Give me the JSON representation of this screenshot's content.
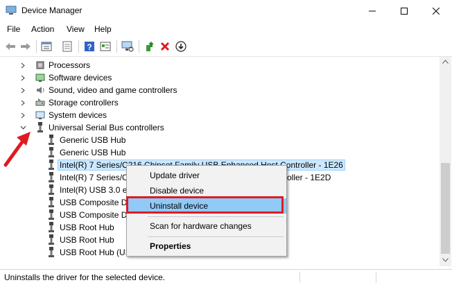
{
  "window": {
    "title": "Device Manager"
  },
  "menu": {
    "items": [
      "File",
      "Action",
      "View",
      "Help"
    ]
  },
  "toolbar": {
    "icons": [
      "back-icon",
      "forward-icon",
      "properties-icon",
      "view-hidden-icon",
      "help-icon",
      "details-icon",
      "scan-hardware-icon",
      "update-driver-icon",
      "uninstall-icon",
      "disable-icon"
    ]
  },
  "tree": {
    "categories": [
      {
        "label": "Processors",
        "icon": "processor-icon"
      },
      {
        "label": "Software devices",
        "icon": "software-device-icon"
      },
      {
        "label": "Sound, video and game controllers",
        "icon": "sound-icon"
      },
      {
        "label": "Storage controllers",
        "icon": "storage-icon"
      },
      {
        "label": "System devices",
        "icon": "system-device-icon"
      },
      {
        "label": "Universal Serial Bus controllers",
        "icon": "usb-icon"
      }
    ],
    "usb_children": [
      "Generic USB Hub",
      "Generic USB Hub",
      "Intel(R) 7 Series/C216 Chipset Family USB Enhanced Host Controller - 1E26",
      "Intel(R) 7 Series/C216 Chipset Family USB Enhanced Host Controller - 1E2D",
      "Intel(R) USB 3.0 eXtensible Host Controller - 1.0 (Microsoft)",
      "USB Composite Device",
      "USB Composite Device",
      "USB Root Hub",
      "USB Root Hub",
      "USB Root Hub (USB 3.0)"
    ],
    "visible_child_text": [
      "Generic USB Hub",
      "Generic USB Hub",
      "Intel(R) 7 Series/C216 Chipset Family USB Enhanced Host Controller - 1E26",
      "Intel(R) 7 Series/C2",
      "Intel(R) USB 3.0 eX",
      "USB Composite De",
      "USB Composite De",
      "USB Root Hub",
      "USB Root Hub",
      "USB Root Hub (US"
    ],
    "partial_suffix_row4": "oller - 1E2D"
  },
  "context_menu": {
    "items": [
      "Update driver",
      "Disable device",
      "Uninstall device",
      "Scan for hardware changes",
      "Properties"
    ],
    "highlighted": "Uninstall device"
  },
  "status": {
    "text": "Uninstalls the driver for the selected device."
  },
  "colors": {
    "highlight": "#91c9f7",
    "selection": "#cce8ff",
    "annotation_red": "#e01a22"
  }
}
